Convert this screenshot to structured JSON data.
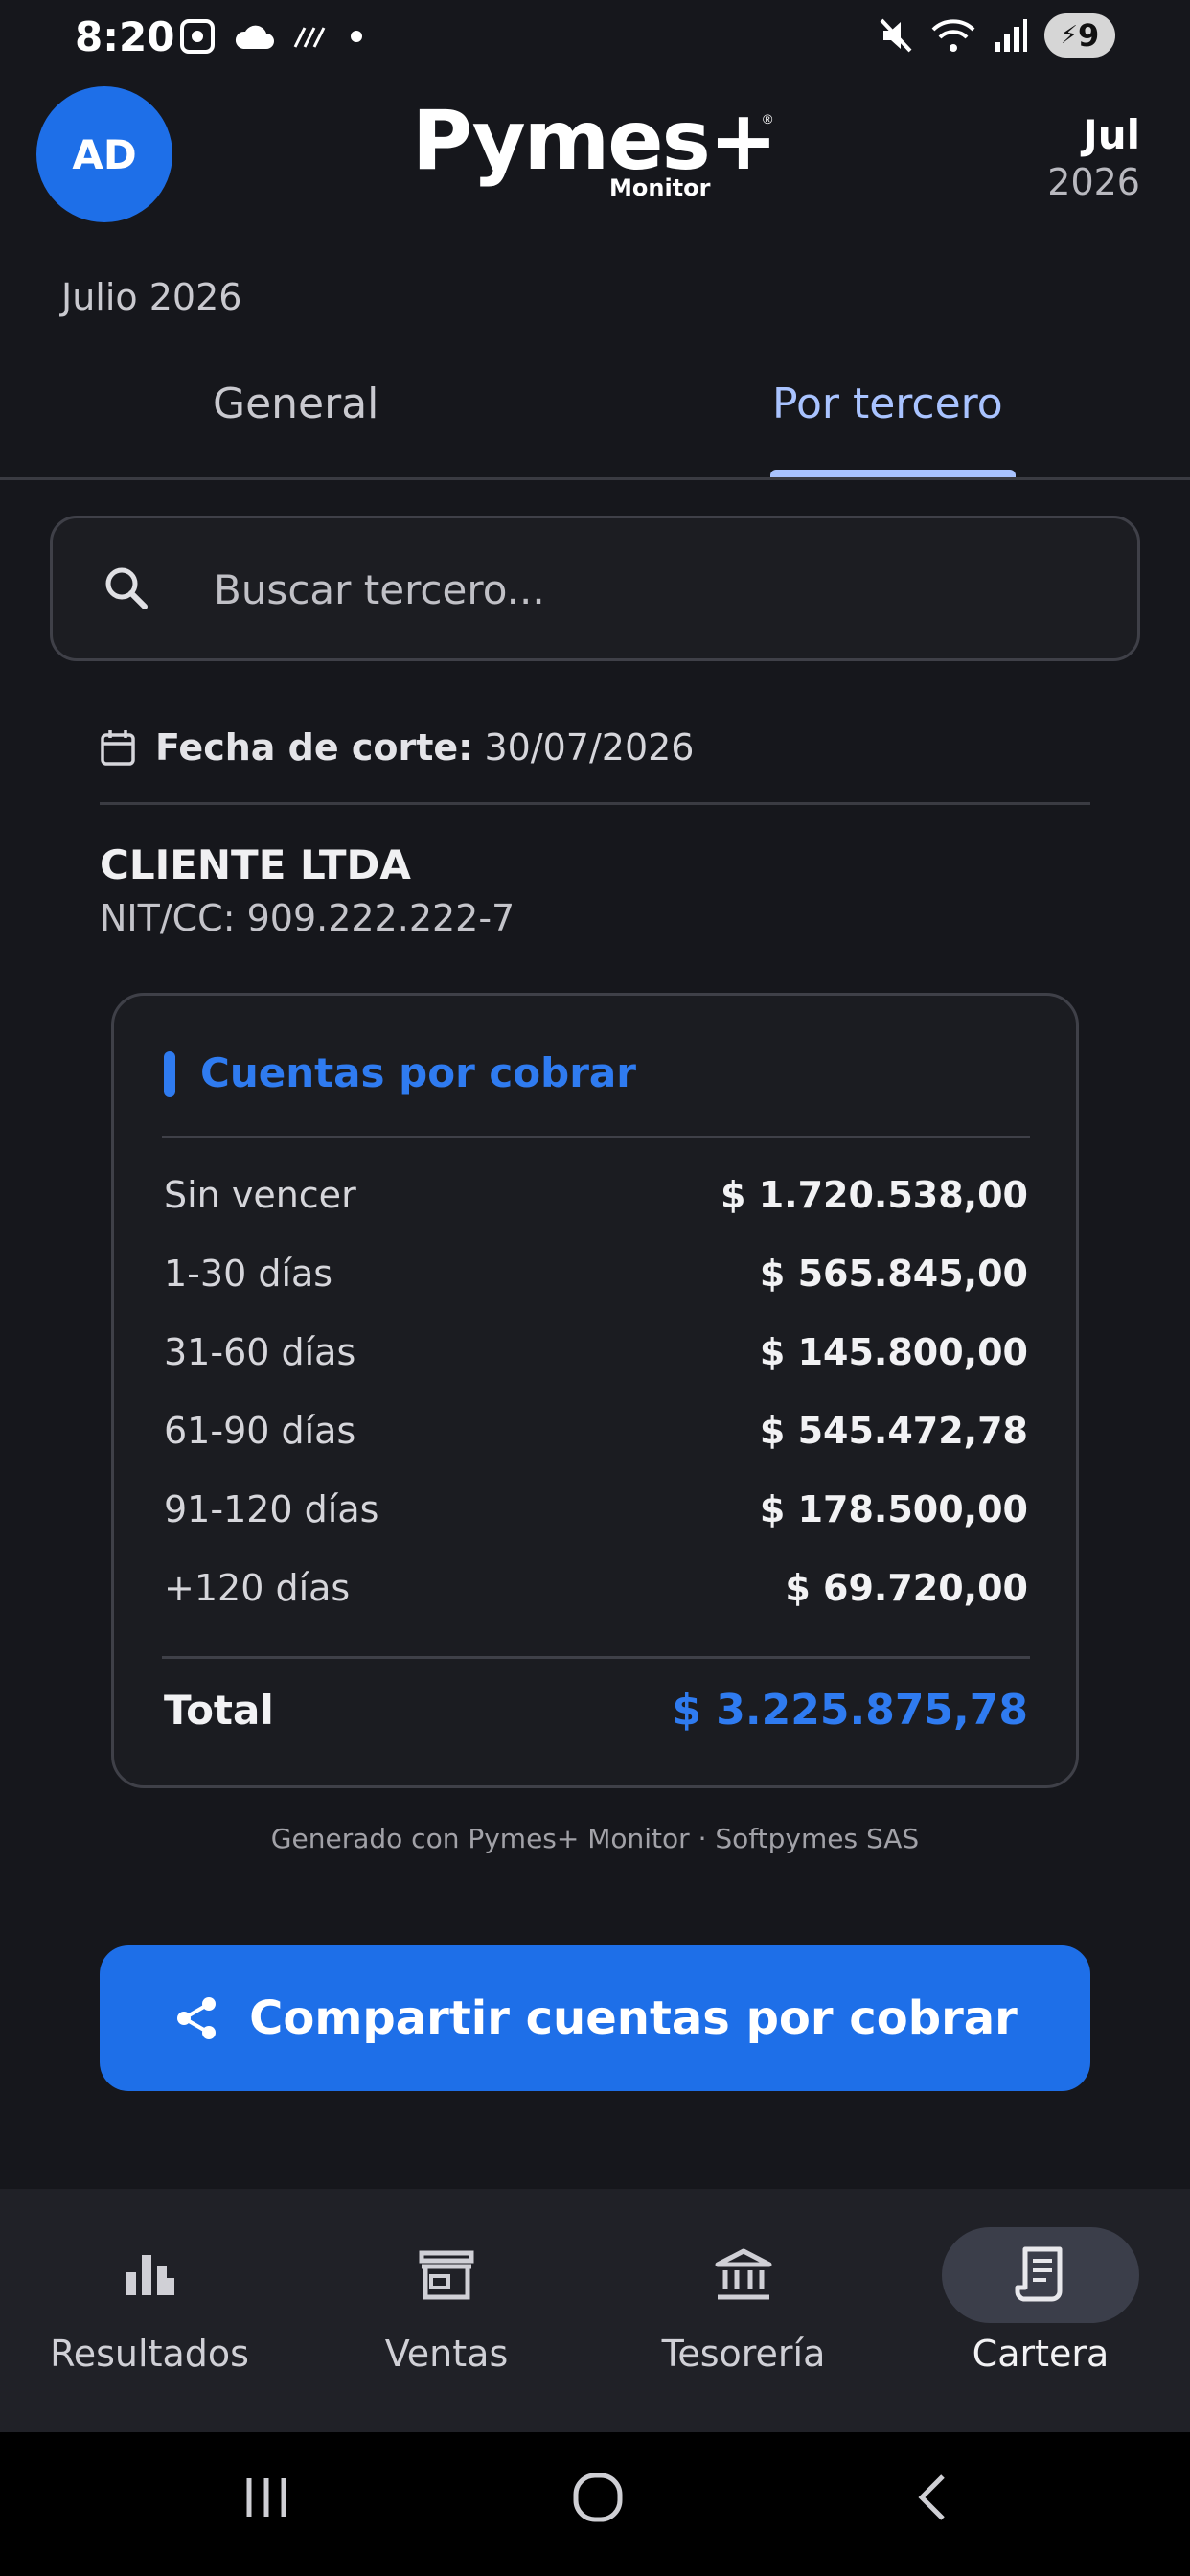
{
  "status_bar": {
    "time": "8:20",
    "battery": "9"
  },
  "header": {
    "avatar_initials": "AD",
    "logo_main": "Pymes+",
    "logo_sub": "Monitor",
    "logo_reg": "®",
    "period_month": "Jul",
    "period_year": "2026",
    "subtitle": "Julio 2026"
  },
  "tabs": [
    {
      "label": "General",
      "active": false
    },
    {
      "label": "Por tercero",
      "active": true
    }
  ],
  "search": {
    "placeholder": "Buscar tercero...",
    "value": ""
  },
  "cutoff": {
    "label": "Fecha de corte:",
    "date": "30/07/2026"
  },
  "client": {
    "name": "CLIENTE LTDA",
    "nit": "NIT/CC: 909.222.222-7"
  },
  "receivables": {
    "title": "Cuentas por cobrar",
    "rows": [
      {
        "label": "Sin vencer",
        "value": "$ 1.720.538,00"
      },
      {
        "label": "1-30 días",
        "value": "$ 565.845,00"
      },
      {
        "label": "31-60 días",
        "value": "$ 145.800,00"
      },
      {
        "label": "61-90 días",
        "value": "$ 545.472,78"
      },
      {
        "label": "91-120 días",
        "value": "$ 178.500,00"
      },
      {
        "label": "+120 días",
        "value": "$ 69.720,00"
      }
    ],
    "total_label": "Total",
    "total_value": "$ 3.225.875,78"
  },
  "footer_note": "Generado con Pymes+ Monitor · Softpymes SAS",
  "share_button": {
    "label": "Compartir cuentas por cobrar"
  },
  "bottom_nav": [
    {
      "label": "Resultados",
      "icon": "bar-chart-icon",
      "active": false
    },
    {
      "label": "Ventas",
      "icon": "storefront-icon",
      "active": false
    },
    {
      "label": "Tesorería",
      "icon": "bank-icon",
      "active": false
    },
    {
      "label": "Cartera",
      "icon": "receipt-icon",
      "active": true
    }
  ],
  "colors": {
    "accent": "#1e6fe8",
    "accent_text": "#2f7bf0",
    "tab_active": "#a9c3ff",
    "background": "#16171c"
  }
}
